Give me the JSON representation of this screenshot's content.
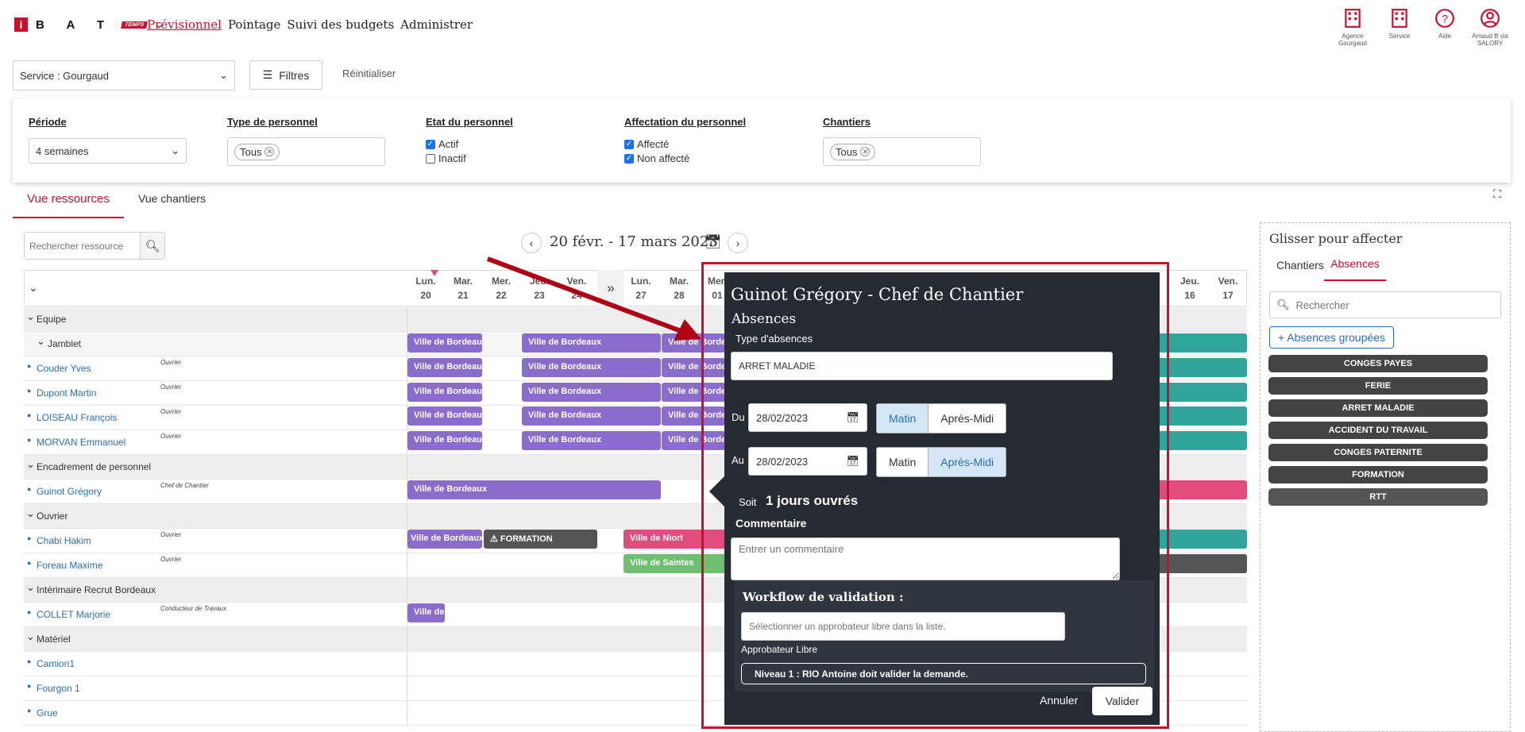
{
  "topnav": {
    "logo_letters": "B A T",
    "logo_temps": "TEMPS",
    "items": [
      "Prévisionnel",
      "Pointage",
      "Suivi des budgets",
      "Administrer"
    ],
    "icons": [
      {
        "name": "building-icon",
        "label": "Agence Gourgaud"
      },
      {
        "name": "building-icon",
        "label": "Service"
      },
      {
        "name": "help-icon",
        "label": "Aide"
      },
      {
        "name": "user-icon",
        "label": "Arnaud B via SALORY"
      }
    ]
  },
  "toolbar": {
    "service_select": "Service : Gourgaud",
    "filters_button": "Filtres",
    "reset_button": "Réinitialiser"
  },
  "filters": {
    "periode": {
      "label": "Période",
      "value": "4 semaines"
    },
    "type_personnel": {
      "label": "Type de personnel",
      "tag": "Tous"
    },
    "etat": {
      "label": "Etat du personnel",
      "options": [
        {
          "label": "Actif",
          "checked": true
        },
        {
          "label": "Inactif",
          "checked": false
        }
      ]
    },
    "affectation": {
      "label": "Affectation du personnel",
      "options": [
        {
          "label": "Affecté",
          "checked": true
        },
        {
          "label": "Non affecté",
          "checked": true
        }
      ]
    },
    "chantiers": {
      "label": "Chantiers",
      "tag": "Tous"
    }
  },
  "view_tabs": [
    "Vue ressources",
    "Vue chantiers"
  ],
  "resource_search_placeholder": "Rechercher ressource",
  "date_range": "20 févr. - 17 mars 2023",
  "day_headers": [
    {
      "d": "Lun.",
      "n": "20"
    },
    {
      "d": "Mar.",
      "n": "21"
    },
    {
      "d": "Mer.",
      "n": "22"
    },
    {
      "d": "Jeu.",
      "n": "23"
    },
    {
      "d": "Ven.",
      "n": "24"
    },
    {
      "d": "Lun.",
      "n": "27"
    },
    {
      "d": "Mar.",
      "n": "28"
    },
    {
      "d": "Mer.",
      "n": "01"
    },
    {
      "d": "Jeu.",
      "n": "16"
    },
    {
      "d": "Ven.",
      "n": "17"
    }
  ],
  "rows": [
    {
      "type": "group",
      "name": "Equipe"
    },
    {
      "type": "subgroup",
      "name": "Jamblet"
    },
    {
      "type": "person",
      "name": "Couder Yves",
      "role": "Ouvrier"
    },
    {
      "type": "person",
      "name": "Dupont Martin",
      "role": "Ouvrier"
    },
    {
      "type": "person",
      "name": "LOISEAU François",
      "role": "Ouvrier"
    },
    {
      "type": "person",
      "name": "MORVAN Emmanuel",
      "role": "Ouvrier"
    },
    {
      "type": "group",
      "name": "Encadrement de personnel"
    },
    {
      "type": "person",
      "name": "Guinot Grégory",
      "role": "Chef de Chantier"
    },
    {
      "type": "group",
      "name": "Ouvrier"
    },
    {
      "type": "person",
      "name": "Chabi Hakim",
      "role": "Ouvrier"
    },
    {
      "type": "person",
      "name": "Foreau Maxime",
      "role": "Ouvrier"
    },
    {
      "type": "group",
      "name": "Intérimaire Recrut Bordeaux"
    },
    {
      "type": "person",
      "name": "COLLET Marjorie",
      "role": "Conducteur de Travaux"
    },
    {
      "type": "group",
      "name": "Matériel"
    },
    {
      "type": "person",
      "name": "Camion1",
      "role": ""
    },
    {
      "type": "person",
      "name": "Fourgon 1",
      "role": ""
    },
    {
      "type": "person",
      "name": "Grue",
      "role": ""
    }
  ],
  "bars": {
    "bordeaux": "Ville de Bordeaux",
    "bordeaux_short": "Ville de",
    "formation": "FORMATION",
    "niort": "Ville de Niort",
    "saintes": "Ville de Saintes"
  },
  "modal": {
    "title": "Guinot Grégory - Chef de Chantier",
    "subtitle": "Absences",
    "type_label": "Type d'absences",
    "type_value": "ARRET MALADIE",
    "du_label": "Du",
    "du_value": "28/02/2023",
    "au_label": "Au",
    "au_value": "28/02/2023",
    "matin": "Matin",
    "apres_midi": "Après-Midi",
    "soit_label": "Soit",
    "soit_value": "1 jours ouvrés",
    "comment_label": "Commentaire",
    "comment_placeholder": "Entrer un commentaire",
    "workflow_label": "Workflow de validation :",
    "approver_placeholder": "Sélectionner un approbateur libre dans la liste.",
    "approver_label": "Approbateur Libre",
    "level_text": "Niveau 1 : RIO Antoine doit valider la demande.",
    "cancel": "Annuler",
    "submit": "Valider"
  },
  "side_panel": {
    "title": "Glisser pour affecter",
    "tabs": [
      "Chantiers",
      "Absences"
    ],
    "search_placeholder": "Rechercher",
    "grouped_button": "Absences groupées",
    "absences": [
      "CONGES PAYES",
      "FERIE",
      "ARRET MALADIE",
      "ACCIDENT DU TRAVAIL",
      "CONGES PATERNITE",
      "FORMATION",
      "RTT"
    ]
  },
  "colors": {
    "accent": "#c8102e",
    "purple": "#8a6ccf",
    "teal": "#2ea69b",
    "pink": "#e04d7c",
    "green": "#6cc070",
    "modal_bg": "#262b33"
  }
}
